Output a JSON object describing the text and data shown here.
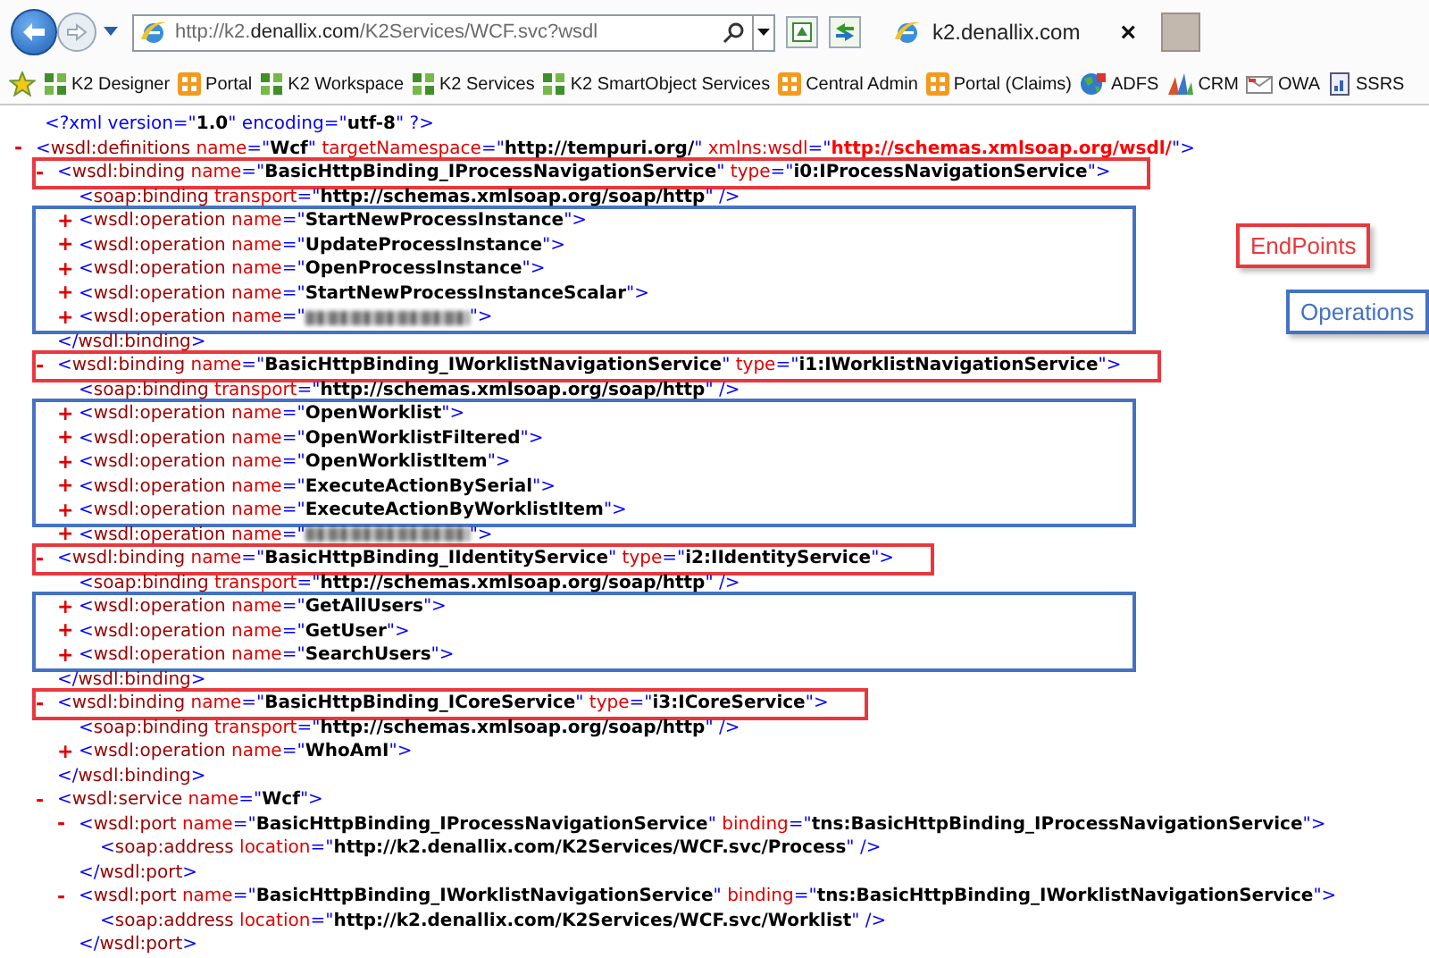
{
  "browser": {
    "address": "http://k2.**denallix.com**/K2Services/WCF.svc?wsdl",
    "tabs": [
      {
        "label": "k2.denallix.com",
        "selected": true,
        "close": "×"
      }
    ],
    "favorites": [
      {
        "label": "K2 Designer"
      },
      {
        "label": "Portal"
      },
      {
        "label": "K2 Workspace"
      },
      {
        "label": "K2 Services"
      },
      {
        "label": "K2 SmartObject Services"
      },
      {
        "label": "Central Admin"
      },
      {
        "label": "Portal (Claims)"
      },
      {
        "label": "ADFS"
      },
      {
        "label": "CRM"
      },
      {
        "label": "OWA"
      },
      {
        "label": "SSRS"
      }
    ]
  },
  "document": {
    "declaration": [
      {
        "kind": "markup",
        "text": "<?xml version=\""
      },
      {
        "kind": "value",
        "text": "1.0"
      },
      {
        "kind": "markup",
        "text": "\" encoding=\""
      },
      {
        "kind": "value",
        "text": "utf-8"
      },
      {
        "kind": "markup",
        "text": "\" ?>"
      }
    ],
    "root": {
      "kind": "element",
      "toggle": "-",
      "line": [
        {
          "kind": "markup",
          "text": "<"
        },
        {
          "kind": "tag",
          "text": "wsdl:definitions"
        },
        {
          "kind": "attr",
          "text": " name"
        },
        {
          "kind": "markup",
          "text": "=\""
        },
        {
          "kind": "value",
          "text": "Wcf"
        },
        {
          "kind": "markup",
          "text": "\""
        },
        {
          "kind": "attr",
          "text": " targetNamespace"
        },
        {
          "kind": "markup",
          "text": "=\""
        },
        {
          "kind": "value",
          "text": "http://tempuri.org/"
        },
        {
          "kind": "markup",
          "text": "\""
        },
        {
          "kind": "attr",
          "text": " xmlns:wsdl"
        },
        {
          "kind": "markup",
          "text": "=\""
        },
        {
          "kind": "namespace",
          "text": "http://schemas.xmlsoap.org/wsdl/"
        },
        {
          "kind": "markup",
          "text": "\">"
        }
      ],
      "children": [
        {
          "kind": "element",
          "toggle": "-",
          "color": "#e8383d",
          "line": [
            {
              "kind": "markup",
              "text": "<"
            },
            {
              "kind": "tag",
              "text": "wsdl:binding"
            },
            {
              "kind": "attr",
              "text": " name"
            },
            {
              "kind": "markup",
              "text": "=\""
            },
            {
              "kind": "value",
              "text": "BasicHttpBinding_IProcessNavigationService"
            },
            {
              "kind": "markup",
              "text": "\""
            },
            {
              "kind": "attr",
              "text": " type"
            },
            {
              "kind": "markup",
              "text": "=\""
            },
            {
              "kind": "value",
              "text": "i0:IProcessNavigationService"
            },
            {
              "kind": "markup",
              "text": "\">"
            }
          ],
          "children": [
            {
              "kind": "element",
              "line": [
                {
                  "kind": "markup",
                  "text": "<"
                },
                {
                  "kind": "tag",
                  "text": "soap:binding"
                },
                {
                  "kind": "attr",
                  "text": " transport"
                },
                {
                  "kind": "markup",
                  "text": "=\""
                },
                {
                  "kind": "value",
                  "text": "http://schemas.xmlsoap.org/soap/http"
                },
                {
                  "kind": "markup",
                  "text": "\" />"
                }
              ]
            },
            {
              "kind": "frame",
              "color": "#4472c4",
              "children": [
                {
                  "kind": "element",
                  "toggle": "+",
                  "line": [
                    {
                      "kind": "markup",
                      "text": "<"
                    },
                    {
                      "kind": "tag",
                      "text": "wsdl:operation"
                    },
                    {
                      "kind": "attr",
                      "text": " name"
                    },
                    {
                      "kind": "markup",
                      "text": "=\""
                    },
                    {
                      "kind": "value",
                      "text": "StartNewProcessInstance"
                    },
                    {
                      "kind": "markup",
                      "text": "\">"
                    }
                  ]
                },
                {
                  "kind": "element",
                  "toggle": "+",
                  "line": [
                    {
                      "kind": "markup",
                      "text": "<"
                    },
                    {
                      "kind": "tag",
                      "text": "wsdl:operation"
                    },
                    {
                      "kind": "attr",
                      "text": " name"
                    },
                    {
                      "kind": "markup",
                      "text": "=\""
                    },
                    {
                      "kind": "value",
                      "text": "UpdateProcessInstance"
                    },
                    {
                      "kind": "markup",
                      "text": "\">"
                    }
                  ]
                },
                {
                  "kind": "element",
                  "toggle": "+",
                  "line": [
                    {
                      "kind": "markup",
                      "text": "<"
                    },
                    {
                      "kind": "tag",
                      "text": "wsdl:operation"
                    },
                    {
                      "kind": "attr",
                      "text": " name"
                    },
                    {
                      "kind": "markup",
                      "text": "=\""
                    },
                    {
                      "kind": "value",
                      "text": "OpenProcessInstance"
                    },
                    {
                      "kind": "markup",
                      "text": "\">"
                    }
                  ]
                },
                {
                  "kind": "element",
                  "toggle": "+",
                  "line": [
                    {
                      "kind": "markup",
                      "text": "<"
                    },
                    {
                      "kind": "tag",
                      "text": "wsdl:operation"
                    },
                    {
                      "kind": "attr",
                      "text": " name"
                    },
                    {
                      "kind": "markup",
                      "text": "=\""
                    },
                    {
                      "kind": "value",
                      "text": "StartNewProcessInstanceScalar"
                    },
                    {
                      "kind": "markup",
                      "text": "\">"
                    }
                  ]
                },
                {
                  "kind": "element",
                  "toggle": "+",
                  "line": [
                    {
                      "kind": "markup",
                      "text": "<"
                    },
                    {
                      "kind": "tag",
                      "text": "wsdl:operation"
                    },
                    {
                      "kind": "attr",
                      "text": " name"
                    },
                    {
                      "kind": "markup",
                      "text": "=\""
                    },
                    {
                      "kind": "blurred"
                    },
                    {
                      "kind": "markup",
                      "text": "\">"
                    }
                  ]
                }
              ]
            }
          ],
          "end": [
            {
              "kind": "markup",
              "text": "</"
            },
            {
              "kind": "tag",
              "text": "wsdl:binding"
            },
            {
              "kind": "markup",
              "text": ">"
            }
          ]
        },
        {
          "kind": "element",
          "toggle": "-",
          "color": "#e8383d",
          "line": [
            {
              "kind": "markup",
              "text": "<"
            },
            {
              "kind": "tag",
              "text": "wsdl:binding"
            },
            {
              "kind": "attr",
              "text": " name"
            },
            {
              "kind": "markup",
              "text": "=\""
            },
            {
              "kind": "value",
              "text": "BasicHttpBinding_IWorklistNavigationService"
            },
            {
              "kind": "markup",
              "text": "\""
            },
            {
              "kind": "attr",
              "text": " type"
            },
            {
              "kind": "markup",
              "text": "=\""
            },
            {
              "kind": "value",
              "text": "i1:IWorklistNavigationService"
            },
            {
              "kind": "markup",
              "text": "\">"
            }
          ],
          "children": [
            {
              "kind": "element",
              "line": [
                {
                  "kind": "markup",
                  "text": "<"
                },
                {
                  "kind": "tag",
                  "text": "soap:binding"
                },
                {
                  "kind": "attr",
                  "text": " transport"
                },
                {
                  "kind": "markup",
                  "text": "=\""
                },
                {
                  "kind": "value",
                  "text": "http://schemas.xmlsoap.org/soap/http"
                },
                {
                  "kind": "markup",
                  "text": "\" />"
                }
              ]
            },
            {
              "kind": "frame",
              "color": "#4472c4",
              "children": [
                {
                  "kind": "element",
                  "toggle": "+",
                  "line": [
                    {
                      "kind": "markup",
                      "text": "<"
                    },
                    {
                      "kind": "tag",
                      "text": "wsdl:operation"
                    },
                    {
                      "kind": "attr",
                      "text": " name"
                    },
                    {
                      "kind": "markup",
                      "text": "=\""
                    },
                    {
                      "kind": "value",
                      "text": "OpenWorklist"
                    },
                    {
                      "kind": "markup",
                      "text": "\">"
                    }
                  ]
                },
                {
                  "kind": "element",
                  "toggle": "+",
                  "line": [
                    {
                      "kind": "markup",
                      "text": "<"
                    },
                    {
                      "kind": "tag",
                      "text": "wsdl:operation"
                    },
                    {
                      "kind": "attr",
                      "text": " name"
                    },
                    {
                      "kind": "markup",
                      "text": "=\""
                    },
                    {
                      "kind": "value",
                      "text": "OpenWorklistFiltered"
                    },
                    {
                      "kind": "markup",
                      "text": "\">"
                    }
                  ]
                },
                {
                  "kind": "element",
                  "toggle": "+",
                  "line": [
                    {
                      "kind": "markup",
                      "text": "<"
                    },
                    {
                      "kind": "tag",
                      "text": "wsdl:operation"
                    },
                    {
                      "kind": "attr",
                      "text": " name"
                    },
                    {
                      "kind": "markup",
                      "text": "=\""
                    },
                    {
                      "kind": "value",
                      "text": "OpenWorklistItem"
                    },
                    {
                      "kind": "markup",
                      "text": "\">"
                    }
                  ]
                },
                {
                  "kind": "element",
                  "toggle": "+",
                  "line": [
                    {
                      "kind": "markup",
                      "text": "<"
                    },
                    {
                      "kind": "tag",
                      "text": "wsdl:operation"
                    },
                    {
                      "kind": "attr",
                      "text": " name"
                    },
                    {
                      "kind": "markup",
                      "text": "=\""
                    },
                    {
                      "kind": "value",
                      "text": "ExecuteActionBySerial"
                    },
                    {
                      "kind": "markup",
                      "text": "\">"
                    }
                  ]
                },
                {
                  "kind": "element",
                  "toggle": "+",
                  "line": [
                    {
                      "kind": "markup",
                      "text": "<"
                    },
                    {
                      "kind": "tag",
                      "text": "wsdl:operation"
                    },
                    {
                      "kind": "attr",
                      "text": " name"
                    },
                    {
                      "kind": "markup",
                      "text": "=\""
                    },
                    {
                      "kind": "value",
                      "text": "ExecuteActionByWorklistItem"
                    },
                    {
                      "kind": "markup",
                      "text": "\">"
                    }
                  ]
                }
              ]
            },
            {
              "kind": "element",
              "toggle": "+",
              "line": [
                {
                  "kind": "markup",
                  "text": "<"
                },
                {
                  "kind": "tag",
                  "text": "wsdl:operation"
                },
                {
                  "kind": "attr",
                  "text": " name"
                },
                {
                  "kind": "markup",
                  "text": "=\""
                },
                {
                  "kind": "blurred"
                },
                {
                  "kind": "markup",
                  "text": "\">"
                }
              ]
            }
          ]
        },
        {
          "kind": "element",
          "toggle": "-",
          "color": "#e8383d",
          "line": [
            {
              "kind": "markup",
              "text": "<"
            },
            {
              "kind": "tag",
              "text": "wsdl:binding"
            },
            {
              "kind": "attr",
              "text": " name"
            },
            {
              "kind": "markup",
              "text": "=\""
            },
            {
              "kind": "value",
              "text": "BasicHttpBinding_IIdentityService"
            },
            {
              "kind": "markup",
              "text": "\""
            },
            {
              "kind": "attr",
              "text": " type"
            },
            {
              "kind": "markup",
              "text": "=\""
            },
            {
              "kind": "value",
              "text": "i2:IIdentityService"
            },
            {
              "kind": "markup",
              "text": "\">"
            }
          ],
          "children": [
            {
              "kind": "element",
              "line": [
                {
                  "kind": "markup",
                  "text": "<"
                },
                {
                  "kind": "tag",
                  "text": "soap:binding"
                },
                {
                  "kind": "attr",
                  "text": " transport"
                },
                {
                  "kind": "markup",
                  "text": "=\""
                },
                {
                  "kind": "value",
                  "text": "http://schemas.xmlsoap.org/soap/http"
                },
                {
                  "kind": "markup",
                  "text": "\" />"
                }
              ]
            },
            {
              "kind": "frame",
              "color": "#4472c4",
              "children": [
                {
                  "kind": "element",
                  "toggle": "+",
                  "line": [
                    {
                      "kind": "markup",
                      "text": "<"
                    },
                    {
                      "kind": "tag",
                      "text": "wsdl:operation"
                    },
                    {
                      "kind": "attr",
                      "text": " name"
                    },
                    {
                      "kind": "markup",
                      "text": "=\""
                    },
                    {
                      "kind": "value",
                      "text": "GetAllUsers"
                    },
                    {
                      "kind": "markup",
                      "text": "\">"
                    }
                  ]
                },
                {
                  "kind": "element",
                  "toggle": "+",
                  "line": [
                    {
                      "kind": "markup",
                      "text": "<"
                    },
                    {
                      "kind": "tag",
                      "text": "wsdl:operation"
                    },
                    {
                      "kind": "attr",
                      "text": " name"
                    },
                    {
                      "kind": "markup",
                      "text": "=\""
                    },
                    {
                      "kind": "value",
                      "text": "GetUser"
                    },
                    {
                      "kind": "markup",
                      "text": "\">"
                    }
                  ]
                },
                {
                  "kind": "element",
                  "toggle": "+",
                  "line": [
                    {
                      "kind": "markup",
                      "text": "<"
                    },
                    {
                      "kind": "tag",
                      "text": "wsdl:operation"
                    },
                    {
                      "kind": "attr",
                      "text": " name"
                    },
                    {
                      "kind": "markup",
                      "text": "=\""
                    },
                    {
                      "kind": "value",
                      "text": "SearchUsers"
                    },
                    {
                      "kind": "markup",
                      "text": "\">"
                    }
                  ]
                }
              ]
            }
          ],
          "end": [
            {
              "kind": "markup",
              "text": "</"
            },
            {
              "kind": "tag",
              "text": "wsdl:binding"
            },
            {
              "kind": "markup",
              "text": ">"
            }
          ]
        },
        {
          "kind": "element",
          "toggle": "-",
          "color": "#e8383d",
          "line": [
            {
              "kind": "markup",
              "text": "<"
            },
            {
              "kind": "tag",
              "text": "wsdl:binding"
            },
            {
              "kind": "attr",
              "text": " name"
            },
            {
              "kind": "markup",
              "text": "=\""
            },
            {
              "kind": "value",
              "text": "BasicHttpBinding_ICoreService"
            },
            {
              "kind": "markup",
              "text": "\""
            },
            {
              "kind": "attr",
              "text": " type"
            },
            {
              "kind": "markup",
              "text": "=\""
            },
            {
              "kind": "value",
              "text": "i3:ICoreService"
            },
            {
              "kind": "markup",
              "text": "\">"
            }
          ],
          "children": [
            {
              "kind": "element",
              "line": [
                {
                  "kind": "markup",
                  "text": "<"
                },
                {
                  "kind": "tag",
                  "text": "soap:binding"
                },
                {
                  "kind": "attr",
                  "text": " transport"
                },
                {
                  "kind": "markup",
                  "text": "=\""
                },
                {
                  "kind": "value",
                  "text": "http://schemas.xmlsoap.org/soap/http"
                },
                {
                  "kind": "markup",
                  "text": "\" />"
                }
              ]
            },
            {
              "kind": "element",
              "toggle": "+",
              "line": [
                {
                  "kind": "markup",
                  "text": "<"
                },
                {
                  "kind": "tag",
                  "text": "wsdl:operation"
                },
                {
                  "kind": "attr",
                  "text": " name"
                },
                {
                  "kind": "markup",
                  "text": "=\""
                },
                {
                  "kind": "value",
                  "text": "WhoAmI"
                },
                {
                  "kind": "markup",
                  "text": "\">"
                }
              ]
            }
          ],
          "end": [
            {
              "kind": "markup",
              "text": "</"
            },
            {
              "kind": "tag",
              "text": "wsdl:binding"
            },
            {
              "kind": "markup",
              "text": ">"
            }
          ]
        },
        {
          "kind": "element",
          "toggle": "-",
          "line": [
            {
              "kind": "markup",
              "text": "<"
            },
            {
              "kind": "tag",
              "text": "wsdl:service"
            },
            {
              "kind": "attr",
              "text": " name"
            },
            {
              "kind": "markup",
              "text": "=\""
            },
            {
              "kind": "value",
              "text": "Wcf"
            },
            {
              "kind": "markup",
              "text": "\">"
            }
          ],
          "children": [
            {
              "kind": "element",
              "toggle": "-",
              "line": [
                {
                  "kind": "markup",
                  "text": "<"
                },
                {
                  "kind": "tag",
                  "text": "wsdl:port"
                },
                {
                  "kind": "attr",
                  "text": " name"
                },
                {
                  "kind": "markup",
                  "text": "=\""
                },
                {
                  "kind": "value",
                  "text": "BasicHttpBinding_IProcessNavigationService"
                },
                {
                  "kind": "markup",
                  "text": "\""
                },
                {
                  "kind": "attr",
                  "text": " binding"
                },
                {
                  "kind": "markup",
                  "text": "=\""
                },
                {
                  "kind": "value",
                  "text": "tns:BasicHttpBinding_IProcessNavigationService"
                },
                {
                  "kind": "markup",
                  "text": "\">"
                }
              ],
              "children": [
                {
                  "kind": "element",
                  "line": [
                    {
                      "kind": "markup",
                      "text": "<"
                    },
                    {
                      "kind": "tag",
                      "text": "soap:address"
                    },
                    {
                      "kind": "attr",
                      "text": " location"
                    },
                    {
                      "kind": "markup",
                      "text": "=\""
                    },
                    {
                      "kind": "value",
                      "text": "http://k2.denallix.com/K2Services/WCF.svc/Process"
                    },
                    {
                      "kind": "markup",
                      "text": "\" />"
                    }
                  ]
                }
              ],
              "end": [
                {
                  "kind": "markup",
                  "text": "</"
                },
                {
                  "kind": "tag",
                  "text": "wsdl:port"
                },
                {
                  "kind": "markup",
                  "text": ">"
                }
              ]
            },
            {
              "kind": "element",
              "toggle": "-",
              "line": [
                {
                  "kind": "markup",
                  "text": "<"
                },
                {
                  "kind": "tag",
                  "text": "wsdl:port"
                },
                {
                  "kind": "attr",
                  "text": " name"
                },
                {
                  "kind": "markup",
                  "text": "=\""
                },
                {
                  "kind": "value",
                  "text": "BasicHttpBinding_IWorklistNavigationService"
                },
                {
                  "kind": "markup",
                  "text": "\""
                },
                {
                  "kind": "attr",
                  "text": " binding"
                },
                {
                  "kind": "markup",
                  "text": "=\""
                },
                {
                  "kind": "value",
                  "text": "tns:BasicHttpBinding_IWorklistNavigationService"
                },
                {
                  "kind": "markup",
                  "text": "\">"
                }
              ],
              "children": [
                {
                  "kind": "element",
                  "line": [
                    {
                      "kind": "markup",
                      "text": "<"
                    },
                    {
                      "kind": "tag",
                      "text": "soap:address"
                    },
                    {
                      "kind": "attr",
                      "text": " location"
                    },
                    {
                      "kind": "markup",
                      "text": "=\""
                    },
                    {
                      "kind": "value",
                      "text": "http://k2.denallix.com/K2Services/WCF.svc/Worklist"
                    },
                    {
                      "kind": "markup",
                      "text": "\" />"
                    }
                  ]
                }
              ],
              "end": [
                {
                  "kind": "markup",
                  "text": "</"
                },
                {
                  "kind": "tag",
                  "text": "wsdl:port"
                },
                {
                  "kind": "markup",
                  "text": ">"
                }
              ]
            }
          ]
        }
      ]
    }
  },
  "legend": [
    {
      "label": "EndPoints",
      "color": "#e8383d"
    },
    {
      "label": "Operations",
      "color": "#4472c4"
    }
  ]
}
